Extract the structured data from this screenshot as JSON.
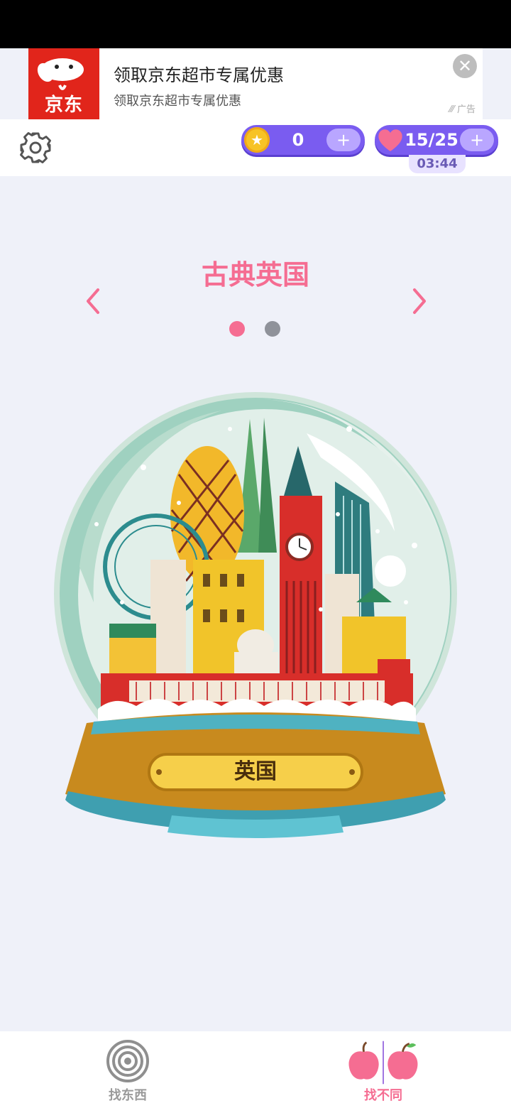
{
  "ad": {
    "logo_text": "京东",
    "title": "领取京东超市专属优惠",
    "subtitle": "领取京东超市专属优惠",
    "tag": "广告",
    "close_icon": "close-icon"
  },
  "top_bar": {
    "coins": "0",
    "lives": "15/25",
    "timer": "03:44",
    "plus": "+",
    "icons": [
      "gear-icon",
      "star-coin-icon",
      "heart-icon"
    ]
  },
  "level": {
    "title": "古典英国",
    "plaque": "英国",
    "page_count": 2,
    "current_page": 1
  },
  "bottom_nav": {
    "items": [
      {
        "label": "找东西",
        "icon": "target-icon",
        "active": false
      },
      {
        "label": "找不同",
        "icon": "twin-apples-icon",
        "active": true
      }
    ]
  },
  "colors": {
    "accent": "#f56d92",
    "pill": "#7a5cf0",
    "background": "#eff1f9"
  }
}
